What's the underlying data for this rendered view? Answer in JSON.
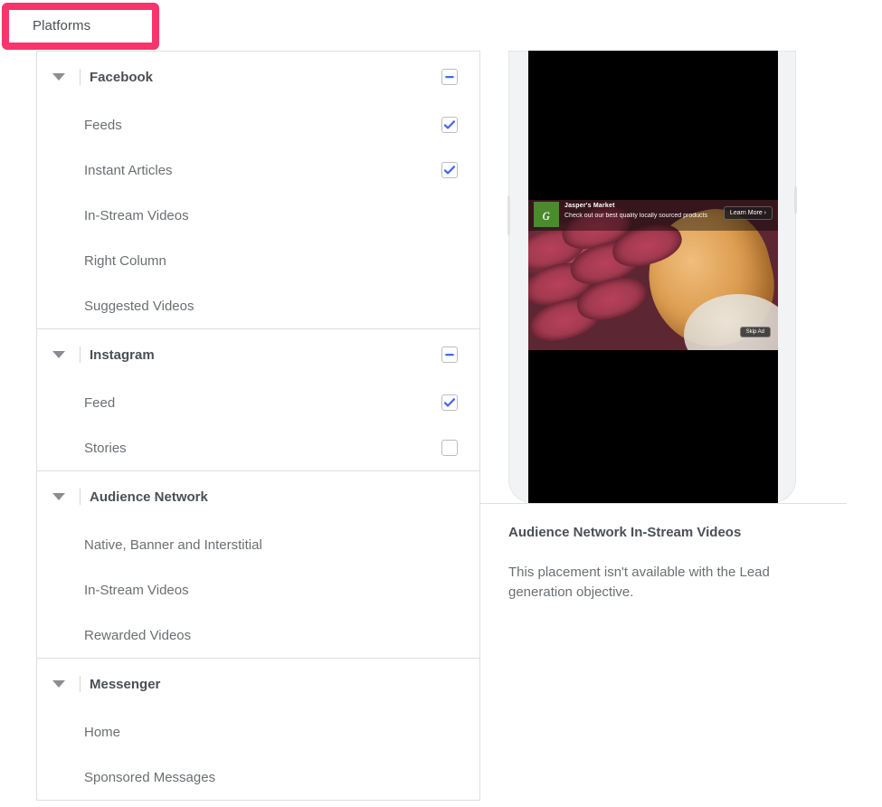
{
  "header": {
    "title": "Platforms",
    "highlight_color": "#f5356b"
  },
  "colors": {
    "accent_pink": "#f5356b",
    "checkbox_blue": "#4267f0",
    "border_gray": "#dddfe2",
    "label_gray": "#6b6f73",
    "heading_gray": "#4b4f56"
  },
  "placements": {
    "sections": [
      {
        "name": "Facebook",
        "caret": "caret-down-icon",
        "checkbox_state": "indeterminate",
        "items": [
          {
            "label": "Feeds",
            "checkbox_state": "checked"
          },
          {
            "label": "Instant Articles",
            "checkbox_state": "checked"
          },
          {
            "label": "In-Stream Videos",
            "checkbox_state": "none"
          },
          {
            "label": "Right Column",
            "checkbox_state": "none"
          },
          {
            "label": "Suggested Videos",
            "checkbox_state": "none"
          }
        ]
      },
      {
        "name": "Instagram",
        "caret": "caret-down-icon",
        "checkbox_state": "indeterminate",
        "items": [
          {
            "label": "Feed",
            "checkbox_state": "checked"
          },
          {
            "label": "Stories",
            "checkbox_state": "unchecked"
          }
        ]
      },
      {
        "name": "Audience Network",
        "caret": "caret-down-icon",
        "checkbox_state": "none",
        "items": [
          {
            "label": "Native, Banner and Interstitial",
            "checkbox_state": "none"
          },
          {
            "label": "In-Stream Videos",
            "checkbox_state": "none"
          },
          {
            "label": "Rewarded Videos",
            "checkbox_state": "none"
          }
        ]
      },
      {
        "name": "Messenger",
        "caret": "caret-down-icon",
        "checkbox_state": "none",
        "items": [
          {
            "label": "Home",
            "checkbox_state": "none"
          },
          {
            "label": "Sponsored Messages",
            "checkbox_state": "none"
          }
        ]
      }
    ]
  },
  "preview": {
    "ad": {
      "advertiser": "Jasper's Market",
      "description": "Check out our best quality locally sourced products",
      "cta_label": "Learn More ›",
      "skip_label": "Skip Ad",
      "logo_glyph": "ɢ"
    },
    "title": "Audience Network In-Stream Videos",
    "body": "This placement isn't available with the Lead generation objective."
  }
}
